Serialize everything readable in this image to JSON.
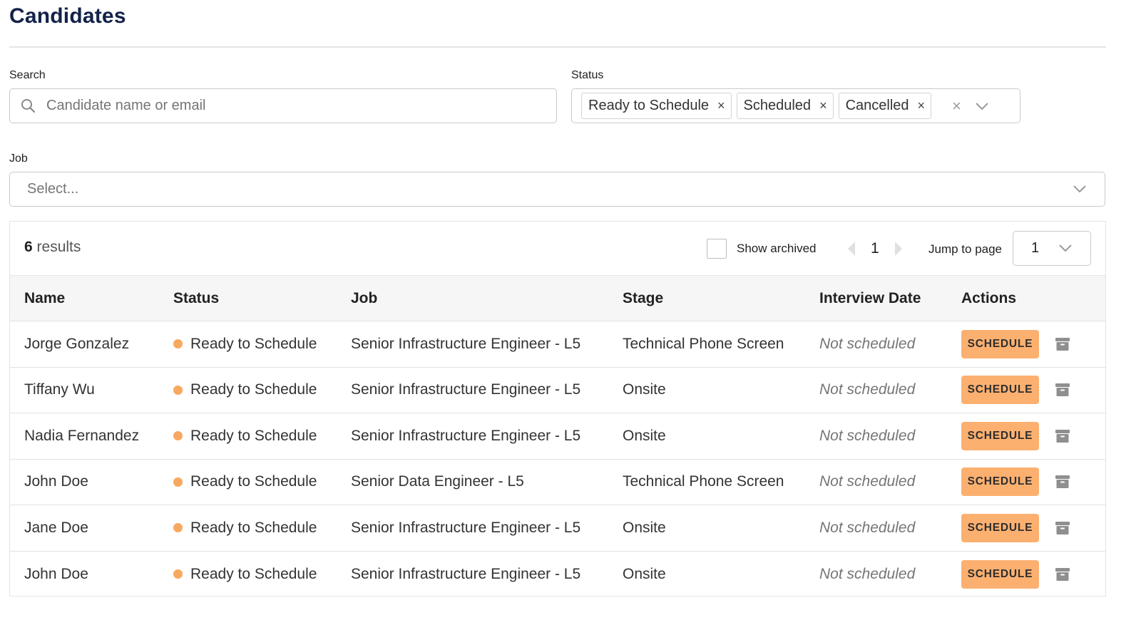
{
  "page": {
    "title": "Candidates"
  },
  "filters": {
    "search": {
      "label": "Search",
      "placeholder": "Candidate name or email",
      "value": ""
    },
    "status": {
      "label": "Status",
      "chips": [
        {
          "label": "Ready to Schedule",
          "remove": "×"
        },
        {
          "label": "Scheduled",
          "remove": "×"
        },
        {
          "label": "Cancelled",
          "remove": "×"
        }
      ],
      "clear_all": "×"
    },
    "job": {
      "label": "Job",
      "placeholder": "Select..."
    }
  },
  "toolbar": {
    "results_count": "6",
    "results_label": "results",
    "show_archived_label": "Show archived",
    "show_archived_checked": false,
    "current_page": "1",
    "jump_label": "Jump to page",
    "jump_value": "1"
  },
  "table": {
    "headers": {
      "name": "Name",
      "status": "Status",
      "job": "Job",
      "stage": "Stage",
      "date": "Interview Date",
      "actions": "Actions"
    },
    "rows": [
      {
        "name": "Jorge Gonzalez",
        "status": "Ready to Schedule",
        "job": "Senior Infrastructure Engineer - L5",
        "stage": "Technical Phone Screen",
        "date": "Not scheduled",
        "action": "SCHEDULE"
      },
      {
        "name": "Tiffany Wu",
        "status": "Ready to Schedule",
        "job": "Senior Infrastructure Engineer - L5",
        "stage": "Onsite",
        "date": "Not scheduled",
        "action": "SCHEDULE"
      },
      {
        "name": "Nadia Fernandez",
        "status": "Ready to Schedule",
        "job": "Senior Infrastructure Engineer - L5",
        "stage": "Onsite",
        "date": "Not scheduled",
        "action": "SCHEDULE"
      },
      {
        "name": "John Doe",
        "status": "Ready to Schedule",
        "job": "Senior Data Engineer - L5",
        "stage": "Technical Phone Screen",
        "date": "Not scheduled",
        "action": "SCHEDULE"
      },
      {
        "name": "Jane Doe",
        "status": "Ready to Schedule",
        "job": "Senior Infrastructure Engineer - L5",
        "stage": "Onsite",
        "date": "Not scheduled",
        "action": "SCHEDULE"
      },
      {
        "name": "John Doe",
        "status": "Ready to Schedule",
        "job": "Senior Infrastructure Engineer - L5",
        "stage": "Onsite",
        "date": "Not scheduled",
        "action": "SCHEDULE"
      }
    ]
  },
  "colors": {
    "title": "#13224a",
    "status_dot": "#f8a860",
    "schedule_button": "#fcb070",
    "header_bg": "#f6f6f6"
  },
  "icons": {
    "search": "search-icon",
    "chip_remove": "close-icon",
    "clear_all": "clear-icon",
    "dropdown": "chevron-down-icon",
    "prev_page": "chevron-left-icon",
    "next_page": "chevron-right-icon",
    "archive": "archive-icon"
  }
}
